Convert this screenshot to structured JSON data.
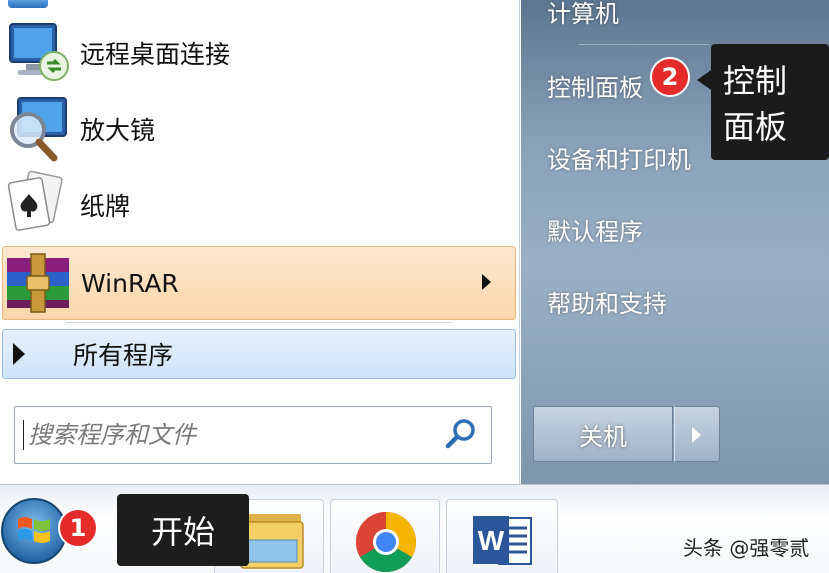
{
  "start_menu": {
    "programs": [
      {
        "label": "远程桌面连接",
        "icon": "remote-desktop-icon"
      },
      {
        "label": "放大镜",
        "icon": "magnifier-icon"
      },
      {
        "label": "纸牌",
        "icon": "solitaire-cards-icon"
      },
      {
        "label": "WinRAR",
        "icon": "winrar-icon",
        "has_submenu": true
      }
    ],
    "all_programs_label": "所有程序",
    "search": {
      "placeholder": "搜索程序和文件",
      "value": ""
    },
    "right_links": {
      "computer": "计算机",
      "control_panel": "控制面板",
      "devices_printers": "设备和打印机",
      "default_programs": "默认程序",
      "help_support": "帮助和支持"
    },
    "shutdown_label": "关机"
  },
  "callouts": {
    "start": {
      "number": "1",
      "text": "开始"
    },
    "control_panel": {
      "number": "2",
      "text_line1": "控制",
      "text_line2": "面板"
    }
  },
  "taskbar": {
    "items": [
      {
        "name": "windows-explorer",
        "icon": "folder-icon"
      },
      {
        "name": "chrome",
        "icon": "chrome-icon"
      },
      {
        "name": "word",
        "icon": "word-icon"
      }
    ]
  },
  "watermark": "头条 @强零贰",
  "colors": {
    "highlight_item": "#fbd6ab",
    "all_programs_bg": "#cfe3f7",
    "right_pane": "#8aa1b8",
    "badge": "#e52a2a",
    "tooltip_bg": "#1b1b1b"
  }
}
